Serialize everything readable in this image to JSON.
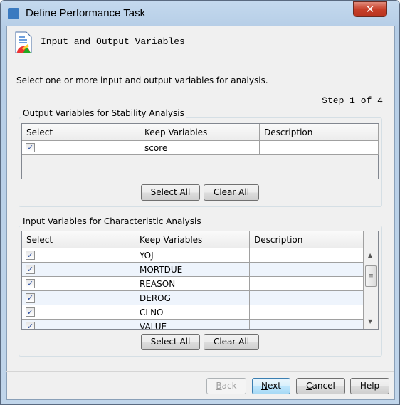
{
  "window": {
    "title": "Define Performance Task"
  },
  "header": {
    "title": "Input and Output Variables"
  },
  "instruction": "Select one or more input and output variables for analysis.",
  "step": "Step 1 of 4",
  "output_group": {
    "title": "Output Variables for Stability Analysis",
    "columns": [
      "Select",
      "Keep Variables",
      "Description"
    ],
    "rows": [
      {
        "checked": true,
        "variable": "score",
        "description": ""
      }
    ],
    "select_all": "Select All",
    "clear_all": "Clear All"
  },
  "input_group": {
    "title": "Input Variables for Characteristic Analysis",
    "columns": [
      "Select",
      "Keep Variables",
      "Description"
    ],
    "rows": [
      {
        "checked": true,
        "variable": "YOJ",
        "description": ""
      },
      {
        "checked": true,
        "variable": "MORTDUE",
        "description": ""
      },
      {
        "checked": true,
        "variable": "REASON",
        "description": ""
      },
      {
        "checked": true,
        "variable": "DEROG",
        "description": ""
      },
      {
        "checked": true,
        "variable": "CLNO",
        "description": ""
      },
      {
        "checked": true,
        "variable": "VALUE",
        "description": ""
      }
    ],
    "select_all": "Select All",
    "clear_all": "Clear All"
  },
  "footer": {
    "back": "Back",
    "next": "Next",
    "cancel": "Cancel",
    "help": "Help"
  },
  "colors": {
    "alt_row": "#eef4fc",
    "default_button": "#bee6fd"
  }
}
